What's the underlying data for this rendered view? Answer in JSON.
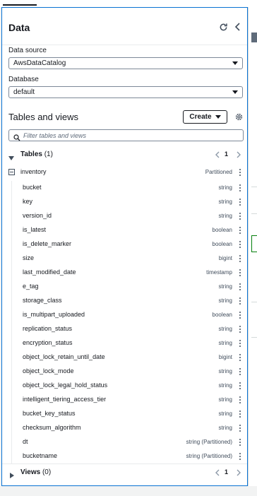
{
  "panel": {
    "title": "Data"
  },
  "data_source": {
    "label": "Data source",
    "value": "AwsDataCatalog"
  },
  "database": {
    "label": "Database",
    "value": "default"
  },
  "tables_views": {
    "title": "Tables and views",
    "create_label": "Create",
    "search_placeholder": "Filter tables and views"
  },
  "tables_section": {
    "title": "Tables",
    "count": "(1)",
    "page": "1"
  },
  "table": {
    "name": "inventory",
    "type": "Partitioned"
  },
  "columns": [
    {
      "name": "bucket",
      "type": "string"
    },
    {
      "name": "key",
      "type": "string"
    },
    {
      "name": "version_id",
      "type": "string"
    },
    {
      "name": "is_latest",
      "type": "boolean"
    },
    {
      "name": "is_delete_marker",
      "type": "boolean"
    },
    {
      "name": "size",
      "type": "bigint"
    },
    {
      "name": "last_modified_date",
      "type": "timestamp"
    },
    {
      "name": "e_tag",
      "type": "string"
    },
    {
      "name": "storage_class",
      "type": "string"
    },
    {
      "name": "is_multipart_uploaded",
      "type": "boolean"
    },
    {
      "name": "replication_status",
      "type": "string"
    },
    {
      "name": "encryption_status",
      "type": "string"
    },
    {
      "name": "object_lock_retain_until_date",
      "type": "bigint"
    },
    {
      "name": "object_lock_mode",
      "type": "string"
    },
    {
      "name": "object_lock_legal_hold_status",
      "type": "string"
    },
    {
      "name": "intelligent_tiering_access_tier",
      "type": "string"
    },
    {
      "name": "bucket_key_status",
      "type": "string"
    },
    {
      "name": "checksum_algorithm",
      "type": "string"
    },
    {
      "name": "dt",
      "type": "string (Partitioned)"
    },
    {
      "name": "bucketname",
      "type": "string (Partitioned)"
    }
  ],
  "views_section": {
    "title": "Views",
    "count": "(0)",
    "page": "1"
  },
  "icons": {
    "refresh": "refresh-icon",
    "collapse_panel": "chevron-left-icon",
    "settings": "gear-icon",
    "search": "search-icon",
    "row_actions": "kebab-menu-icon"
  },
  "colors": {
    "focus_border": "#0972d3",
    "text": "#16191f",
    "muted": "#414d5c"
  }
}
